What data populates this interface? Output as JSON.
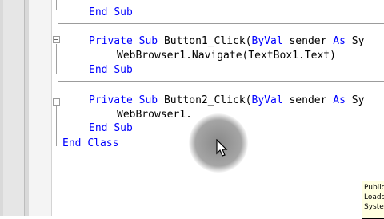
{
  "code": {
    "line1_end": "End",
    "line1_sub": "Sub",
    "line2_private": "Private",
    "line2_sub": "Sub",
    "line2_name": "Button1_Click(",
    "line2_byval": "ByVal",
    "line2_sender": "sender",
    "line2_as": "As",
    "line2_rest": "Sy",
    "line3_text": "WebBrowser1.Navigate(TextBox1.Text)",
    "line4_end": "End",
    "line4_sub": "Sub",
    "line5_private": "Private",
    "line5_sub": "Sub",
    "line5_name": "Button2_Click(",
    "line5_byval": "ByVal",
    "line5_sender": "sender",
    "line5_as": "As",
    "line5_rest": "Sy",
    "line6_text": "WebBrowser1.",
    "line7_end": "End",
    "line7_sub": "Sub",
    "line8_end": "End",
    "line8_class": "Class"
  },
  "tooltip": {
    "line1": "Public",
    "line2": "Loads",
    "line3": "Syste"
  },
  "colors": {
    "keyword": "#0000ff",
    "text": "#000000",
    "tooltip_bg": "#ffffe1"
  }
}
